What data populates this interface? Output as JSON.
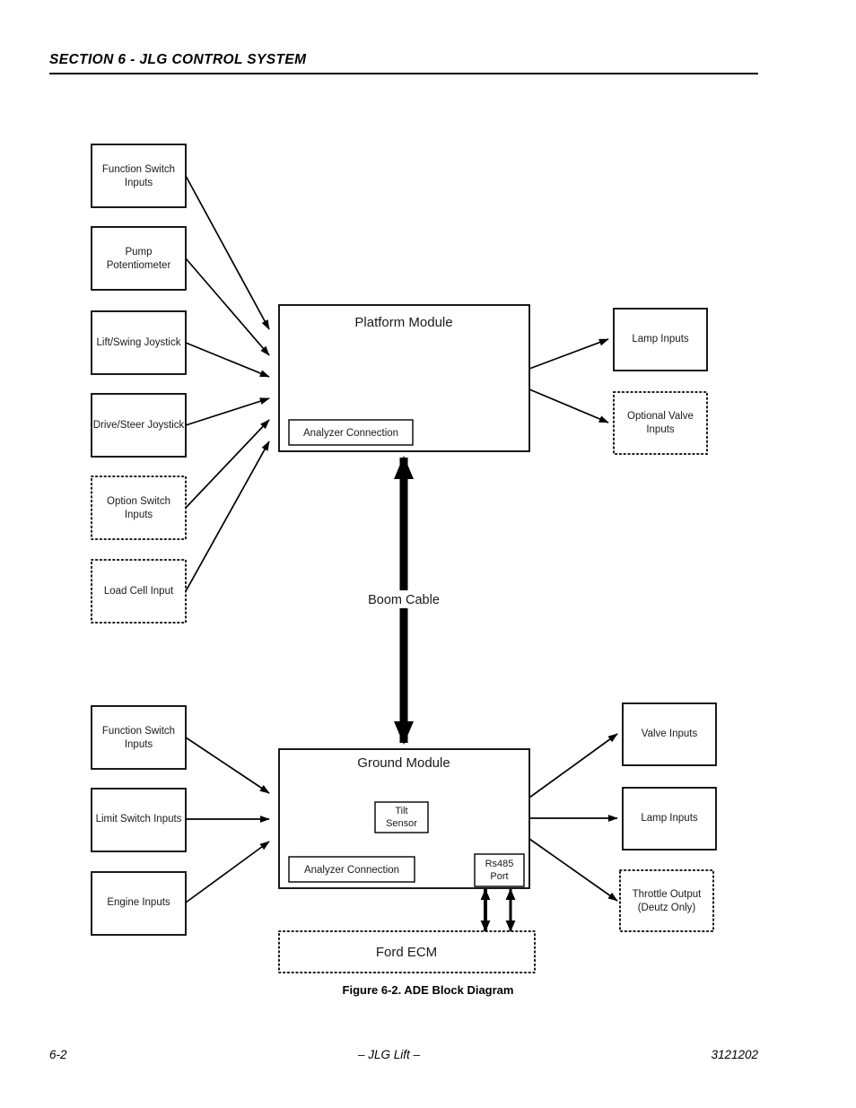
{
  "header": {
    "section_title": "SECTION 6 - JLG CONTROL SYSTEM"
  },
  "figure": {
    "caption": "Figure 6-2.  ADE Block Diagram"
  },
  "footer": {
    "page_number": "6-2",
    "brand": "– JLG Lift –",
    "document_number": "3121202"
  },
  "diagram": {
    "platform_inputs": [
      {
        "label_line1": "Function Switch",
        "label_line2": "Inputs",
        "border": "solid"
      },
      {
        "label_line1": "Pump",
        "label_line2": "Potentiometer",
        "border": "solid"
      },
      {
        "label_line1": "Lift/Swing Joystick",
        "label_line2": "",
        "border": "solid"
      },
      {
        "label_line1": "Drive/Steer Joystick",
        "label_line2": "",
        "border": "solid"
      },
      {
        "label_line1": "Option Switch",
        "label_line2": "Inputs",
        "border": "dotted"
      },
      {
        "label_line1": "Load Cell Input",
        "label_line2": "",
        "border": "dotted"
      }
    ],
    "platform_module": {
      "title": "Platform Module",
      "analyzer": "Analyzer Connection"
    },
    "platform_outputs": [
      {
        "label_line1": "Lamp Inputs",
        "label_line2": "",
        "border": "solid"
      },
      {
        "label_line1": "Optional Valve",
        "label_line2": "Inputs",
        "border": "dotted"
      }
    ],
    "boom_cable": {
      "label": "Boom Cable"
    },
    "ground_inputs": [
      {
        "label_line1": "Function Switch",
        "label_line2": "Inputs",
        "border": "solid"
      },
      {
        "label_line1": "Limit Switch Inputs",
        "label_line2": "",
        "border": "solid"
      },
      {
        "label_line1": "Engine Inputs",
        "label_line2": "",
        "border": "solid"
      }
    ],
    "ground_module": {
      "title": "Ground Module",
      "tilt_sensor_line1": "Tilt",
      "tilt_sensor_line2": "Sensor",
      "analyzer": "Analyzer Connection",
      "rs485_line1": "Rs485",
      "rs485_line2": "Port"
    },
    "ground_outputs": [
      {
        "label_line1": "Valve Inputs",
        "label_line2": "",
        "border": "solid"
      },
      {
        "label_line1": "Lamp Inputs",
        "label_line2": "",
        "border": "solid"
      },
      {
        "label_line1": "Throttle Output",
        "label_line2": "(Deutz Only)",
        "border": "dotted"
      }
    ],
    "ford_ecm": {
      "label": "Ford ECM"
    }
  }
}
